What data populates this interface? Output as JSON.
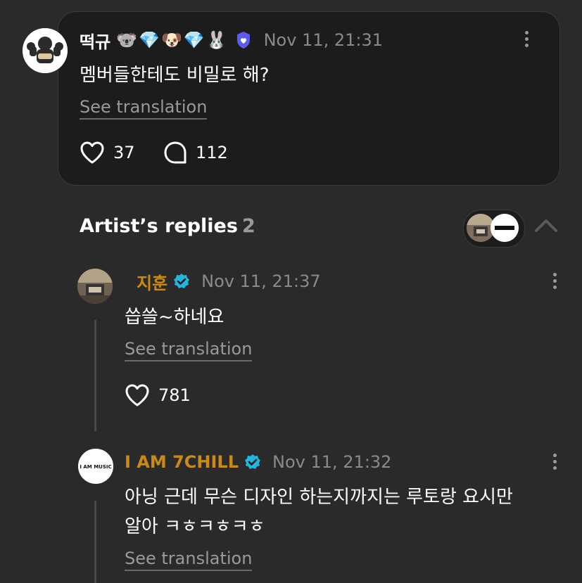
{
  "post": {
    "username": "떡규",
    "badges": "🐨💎🐶💎🐰",
    "timestamp": "Nov 11, 21:31",
    "text": "멤버들한테도 비밀로 해?",
    "see_translation": "See translation",
    "like_count": "37",
    "comment_count": "112"
  },
  "replies_section": {
    "title": "Artist’s replies",
    "count": "2"
  },
  "replies": [
    {
      "username": "지훈",
      "timestamp": "Nov 11, 21:37",
      "text": "씁쓸~하네요",
      "see_translation": "See translation",
      "like_count": "781"
    },
    {
      "username": "I AM 7CHILL",
      "timestamp": "Nov 11, 21:32",
      "text_line1": "아닝 근데 무슨 디자인 하는지까지는 루토랑 요시만",
      "text_line2": "알아 ㅋㅎㅋㅎㅋㅎ",
      "see_translation": "See translation",
      "avatar_text": "I AM MUSIC"
    }
  ],
  "colors": {
    "background": "#2a2a2a",
    "card": "#1c1c1c",
    "artist_name": "#c98a16",
    "verified": "#1fb6e0",
    "member_badge": "#5b5bf0"
  }
}
